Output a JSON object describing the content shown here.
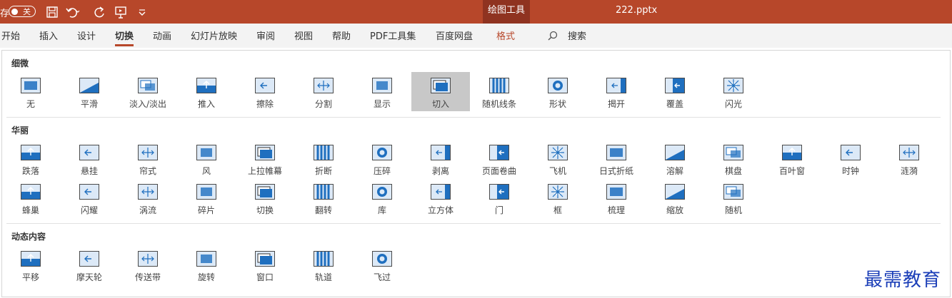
{
  "titlebar": {
    "autosave_prefix": "存",
    "toggle_text": "关",
    "context_tab": "绘图工具",
    "filename": "222.pptx",
    "quick_access_icons": [
      "save-icon",
      "undo-icon",
      "redo-icon",
      "present-icon",
      "customize-icon"
    ]
  },
  "tabs": [
    {
      "label": "开始"
    },
    {
      "label": "插入"
    },
    {
      "label": "设计"
    },
    {
      "label": "切换",
      "active": true
    },
    {
      "label": "动画"
    },
    {
      "label": "幻灯片放映"
    },
    {
      "label": "审阅"
    },
    {
      "label": "视图"
    },
    {
      "label": "帮助"
    },
    {
      "label": "PDF工具集"
    },
    {
      "label": "百度网盘"
    },
    {
      "label": "格式",
      "context": true
    }
  ],
  "search": {
    "label": "搜索"
  },
  "sections": {
    "subtle": {
      "title": "细微",
      "items": [
        "无",
        "平滑",
        "淡入/淡出",
        "推入",
        "擦除",
        "分割",
        "显示",
        "切入",
        "随机线条",
        "形状",
        "揭开",
        "覆盖",
        "闪光"
      ],
      "selected": "切入"
    },
    "exciting": {
      "title": "华丽",
      "row1": [
        "跌落",
        "悬挂",
        "帘式",
        "风",
        "上拉帷幕",
        "折断",
        "压碎",
        "剥离",
        "页面卷曲",
        "飞机",
        "日式折纸",
        "溶解",
        "棋盘",
        "百叶窗",
        "时钟",
        "涟漪"
      ],
      "row2": [
        "蜂巢",
        "闪耀",
        "涡流",
        "碎片",
        "切换",
        "翻转",
        "库",
        "立方体",
        "门",
        "框",
        "梳理",
        "缩放",
        "随机"
      ]
    },
    "dynamic": {
      "title": "动态内容",
      "items": [
        "平移",
        "摩天轮",
        "传送带",
        "旋转",
        "窗口",
        "轨道",
        "飞过"
      ]
    }
  },
  "watermark": "最需教育",
  "colors": {
    "accent": "#b7472a",
    "selected_bg": "#c8c8c8",
    "thumb_fill": "#dce9f7",
    "thumb_blue": "#1f6fbf"
  }
}
